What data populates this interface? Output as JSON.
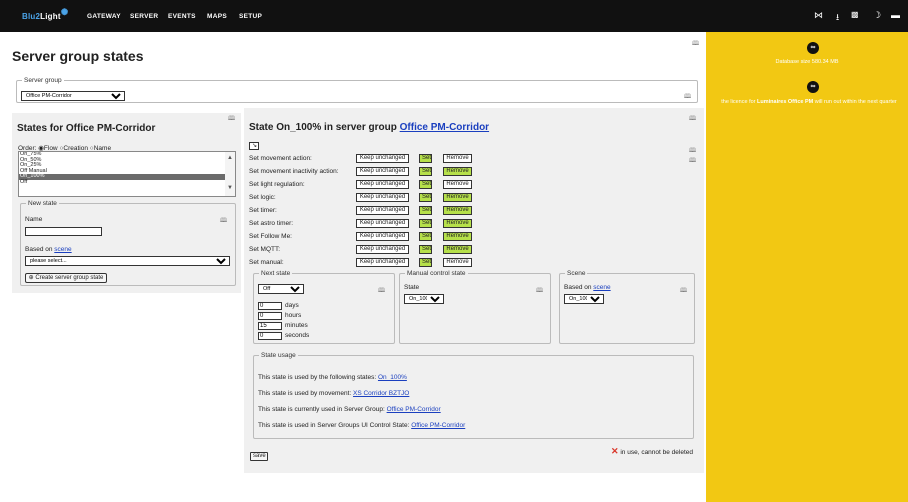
{
  "nav": {
    "logo_a": "Blu2",
    "logo_b": "Light",
    "items": [
      "GATEWAY",
      "SERVER",
      "EVENTS",
      "MAPS",
      "SETUP"
    ]
  },
  "sidebar": {
    "db_text": "Database size 580.34 MB",
    "licence_pre": "the licence for ",
    "licence_bold": "Luminaires Office PM",
    "licence_post": " will run out within the next quarter"
  },
  "page": {
    "title": "Server group states",
    "server_group_legend": "Server group",
    "server_group_value": "Office PM-Corridor"
  },
  "left": {
    "title": "States for Office PM-Corridor",
    "order_label": "Order:",
    "order_options": [
      "Flow",
      "Creation",
      "Name"
    ],
    "order_selected": "Flow",
    "states": [
      "On_75%",
      "On_50%",
      "On_25%",
      "Off Manual",
      "On_100%",
      "Off"
    ],
    "selected_state": "On_100%",
    "new_state_legend": "New state",
    "name_label": "Name",
    "name_value": "",
    "based_on_label": "Based on ",
    "based_on_link": "scene",
    "based_on_placeholder": "please select...",
    "create_button": "Create server group state"
  },
  "right": {
    "title_pre": "State On_100% in server group ",
    "title_link": "Office PM-Corridor",
    "actions": [
      {
        "label": "Set movement action:",
        "remove_active": false
      },
      {
        "label": "Set movement inactivity action:",
        "remove_active": true
      },
      {
        "label": "Set light regulation:",
        "remove_active": false
      },
      {
        "label": "Set logic:",
        "remove_active": true
      },
      {
        "label": "Set timer:",
        "remove_active": true
      },
      {
        "label": "Set astro timer:",
        "remove_active": true
      },
      {
        "label": "Set Follow Me:",
        "remove_active": true
      },
      {
        "label": "Set MQTT:",
        "remove_active": true
      },
      {
        "label": "Set manual:",
        "remove_active": false
      }
    ],
    "keep_label": "Keep unchanged",
    "set_label": "Set",
    "remove_label": "Remove",
    "next_state": {
      "legend": "Next state",
      "value": "Off",
      "days_value": "0",
      "days_label": "days",
      "hours_value": "0",
      "hours_label": "hours",
      "minutes_value": "15",
      "minutes_label": "minutes",
      "seconds_value": "0",
      "seconds_label": "seconds"
    },
    "manual": {
      "legend": "Manual control state",
      "state_label": "State",
      "value": "On_100%"
    },
    "scene": {
      "legend": "Scene",
      "based_on_label": "Based on ",
      "based_on_link": "scene",
      "value": "On_100%"
    },
    "usage": {
      "legend": "State usage",
      "line1_pre": "This state is used by the following states: ",
      "line1_link": "On_100%",
      "line2_pre": "This state is used by movement: ",
      "line2_link": "XS Corridor BZTJO",
      "line3_pre": "This state is currently used in Server Group: ",
      "line3_link": "Office PM-Corridor",
      "line4_pre": "This state is used in Server Groups UI Control State: ",
      "line4_link": "Office PM-Corridor"
    },
    "in_use_text": "in use, cannot be deleted",
    "save_button": "save"
  },
  "colors": {
    "topbar": "#111111",
    "sidebar": "#f2c813",
    "link": "#1a3fbf",
    "set_green": "#b6e04a",
    "delete_red": "#d9372b"
  }
}
